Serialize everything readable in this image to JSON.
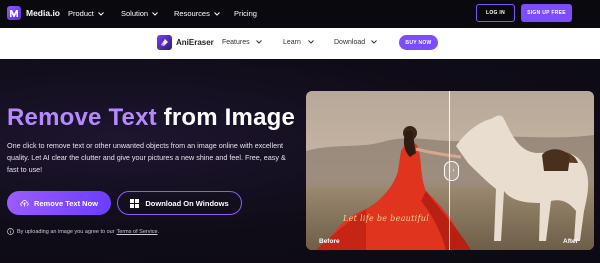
{
  "topnav": {
    "brand": "Media.io",
    "items": [
      {
        "label": "Product",
        "has_chevron": true
      },
      {
        "label": "Solution",
        "has_chevron": true
      },
      {
        "label": "Resources",
        "has_chevron": true
      },
      {
        "label": "Pricing",
        "has_chevron": false
      }
    ],
    "login_label": "LOG IN",
    "signup_label": "SIGN UP FREE"
  },
  "product_bar": {
    "name": "AniEraser",
    "items": [
      "Features",
      "Learn",
      "Download"
    ],
    "buy_label": "BUY NOW"
  },
  "hero": {
    "title_accent": "Remove Text",
    "title_rest": " from Image",
    "description": "One click to remove text or other unwanted objects from an image online with excellent quality. Let AI clear the clutter and give your pictures a new shine and feel. Free, easy & fast to use!",
    "remove_button": "Remove Text Now",
    "download_button": "Download On Windows",
    "terms_prefix": "By uploading an image you agree to our",
    "terms_link": "Terms of Service",
    "terms_suffix": "."
  },
  "compare": {
    "before_label": "Before",
    "after_label": "After",
    "overlay_text": "Let life be beautiful",
    "handle_glyph": "‹ ›"
  },
  "colors": {
    "accent": "#7c4dff",
    "title_accent": "#b48bff",
    "page_bg": "#0d0b12"
  },
  "icons": [
    "media-io-logo",
    "chevron-down-icon",
    "anieraser-logo",
    "upload-cloud-icon",
    "windows-icon",
    "info-icon"
  ]
}
